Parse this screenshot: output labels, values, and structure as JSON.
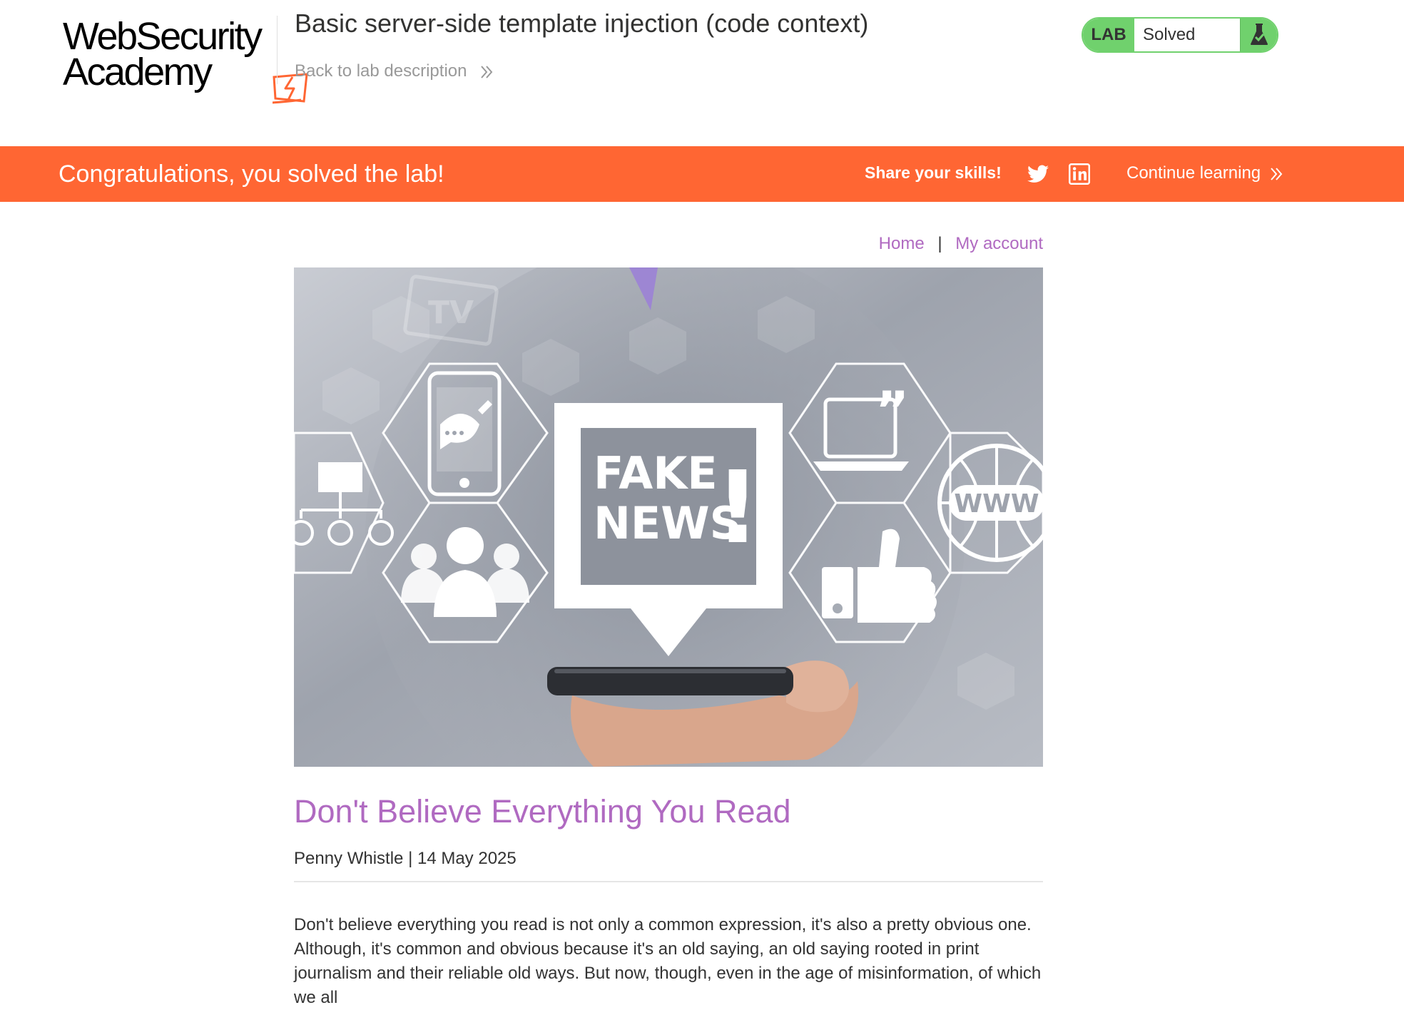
{
  "header": {
    "logo_line1": "WebSecurity",
    "logo_line2": "Academy",
    "lab_title": "Basic server-side template injection (code context)",
    "back_link": "Back to lab description"
  },
  "status": {
    "tag": "LAB",
    "text": "Solved",
    "color": "#70d16d"
  },
  "banner": {
    "congrats": "Congratulations, you solved the lab!",
    "share": "Share your skills!",
    "continue": "Continue learning",
    "color": "#ff6633"
  },
  "nav": {
    "home": "Home",
    "separator": "|",
    "account": "My account",
    "link_color": "#b06ac1"
  },
  "image": {
    "caption_line1": "FAKE",
    "caption_line2": "NEWS",
    "exclaim": "!",
    "www": "WWW",
    "tv": "TV"
  },
  "post": {
    "title": "Don't Believe Everything You Read",
    "meta": "Penny Whistle | 14 May 2025",
    "body": "Don't believe everything you read is not only a common expression, it's also a pretty obvious one. Although, it's common and obvious because it's an old saying, an old saying rooted in print journalism and their reliable old ways. But now, though, even in the age of misinformation, of which we all"
  }
}
